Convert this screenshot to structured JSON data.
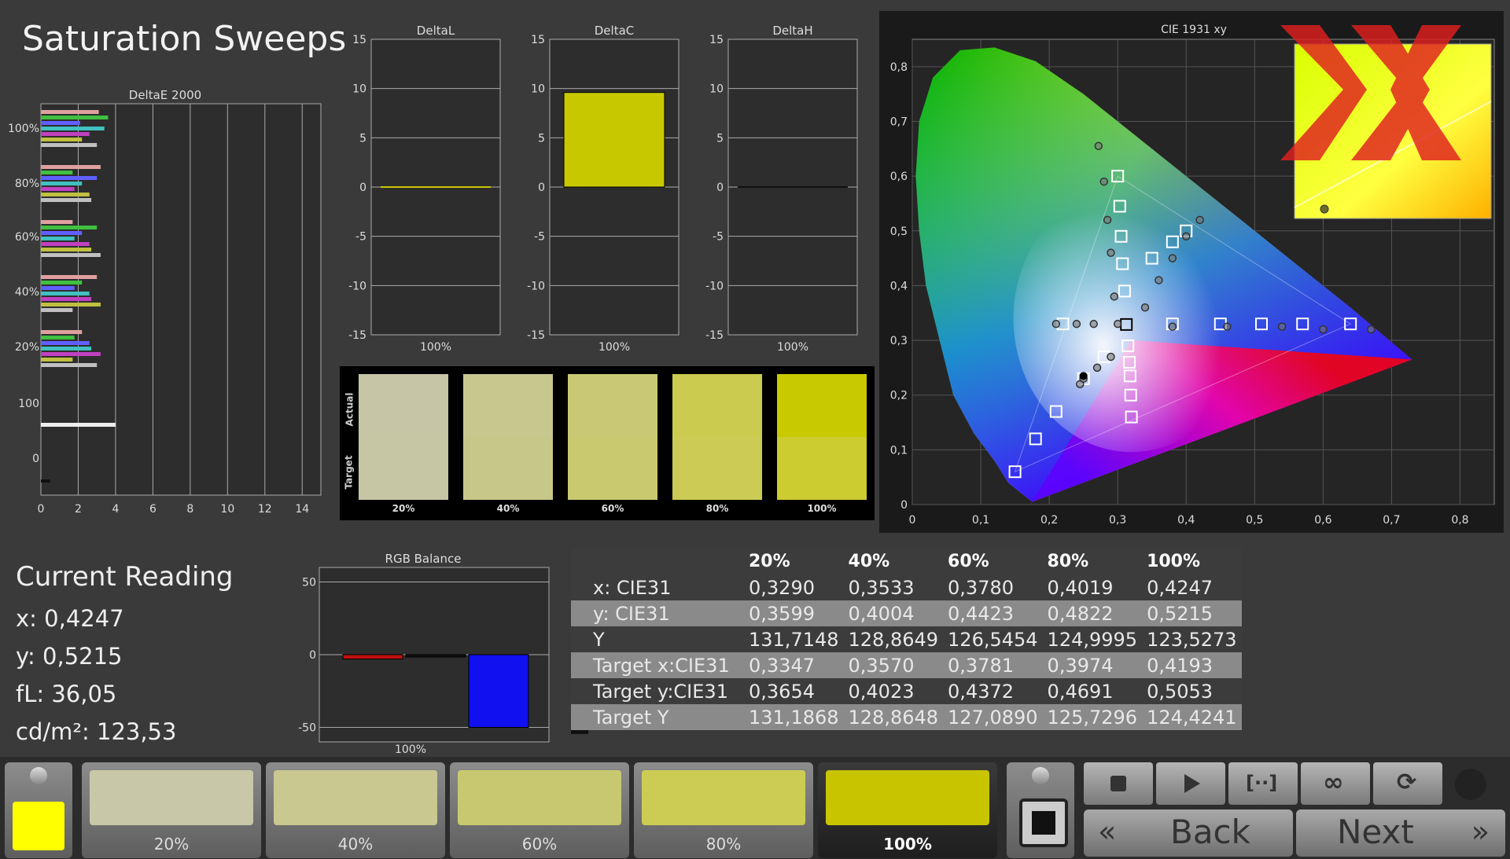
{
  "page_title": "Saturation Sweeps",
  "deltae": {
    "title": "DeltaE 2000",
    "y_labels": [
      "100%",
      "80%",
      "60%",
      "40%",
      "20%",
      "100",
      "0"
    ],
    "x_ticks": [
      "0",
      "2",
      "4",
      "6",
      "8",
      "10",
      "12",
      "14"
    ]
  },
  "mini_charts": [
    {
      "title": "DeltaL",
      "y_ticks": [
        "15",
        "10",
        "5",
        "0",
        "-5",
        "-10",
        "-15"
      ],
      "x_label": "100%",
      "value": 0,
      "color": "#c8c800"
    },
    {
      "title": "DeltaC",
      "y_ticks": [
        "15",
        "10",
        "5",
        "0",
        "-5",
        "-10",
        "-15"
      ],
      "x_label": "100%",
      "value": 9.6,
      "color": "#c8c800"
    },
    {
      "title": "DeltaH",
      "y_ticks": [
        "15",
        "10",
        "5",
        "0",
        "-5",
        "-10",
        "-15"
      ],
      "x_label": "100%",
      "value": 0,
      "color": "#c8c800"
    }
  ],
  "swatches": {
    "actual_label": "Actual",
    "target_label": "Target",
    "items": [
      {
        "label": "20%",
        "actual": "#c6c6a6",
        "target": "#c6c6a4"
      },
      {
        "label": "40%",
        "actual": "#c7c78e",
        "target": "#c7c78a"
      },
      {
        "label": "60%",
        "actual": "#c9c975",
        "target": "#c9c970"
      },
      {
        "label": "80%",
        "actual": "#cbcb50",
        "target": "#cbcb55"
      },
      {
        "label": "100%",
        "actual": "#c9c900",
        "target": "#cccc30"
      }
    ]
  },
  "cie": {
    "title": "CIE 1931 xy",
    "x_ticks": [
      "0",
      "0,1",
      "0,2",
      "0,3",
      "0,4",
      "0,5",
      "0,6",
      "0,7",
      "0,8"
    ],
    "y_ticks": [
      "0",
      "0,1",
      "0,2",
      "0,3",
      "0,4",
      "0,5",
      "0,6",
      "0,7",
      "0,8"
    ]
  },
  "current_reading": {
    "title": "Current Reading",
    "x": "x: 0,4247",
    "y": "y: 0,5215",
    "fl": "fL: 36,05",
    "cd": "cd/m²: 123,53"
  },
  "rgb_balance": {
    "title": "RGB Balance",
    "y_ticks": [
      "50",
      "0",
      "-50"
    ],
    "x_label": "100%",
    "red": -3,
    "green": 0,
    "blue": -50
  },
  "stats_table": {
    "headers": [
      "",
      "20%",
      "40%",
      "60%",
      "80%",
      "100%"
    ],
    "rows": [
      {
        "label": "x: CIE31",
        "values": [
          "0,3290",
          "0,3533",
          "0,3780",
          "0,4019",
          "0,4247"
        ]
      },
      {
        "label": "y: CIE31",
        "values": [
          "0,3599",
          "0,4004",
          "0,4423",
          "0,4822",
          "0,5215"
        ]
      },
      {
        "label": "Y",
        "values": [
          "131,7148",
          "128,8649",
          "126,5454",
          "124,9995",
          "123,5273"
        ]
      },
      {
        "label": "Target x:CIE31",
        "values": [
          "0,3347",
          "0,3570",
          "0,3781",
          "0,3974",
          "0,4193"
        ]
      },
      {
        "label": "Target y:CIE31",
        "values": [
          "0,3654",
          "0,4023",
          "0,4372",
          "0,4691",
          "0,5053"
        ]
      },
      {
        "label": "Target Y",
        "values": [
          "131,1868",
          "128,8648",
          "127,0890",
          "125,7296",
          "124,4241"
        ]
      }
    ]
  },
  "bottom_tiles": [
    {
      "label": "20%",
      "color": "#c8c8a8"
    },
    {
      "label": "40%",
      "color": "#c8c890"
    },
    {
      "label": "60%",
      "color": "#c8c870"
    },
    {
      "label": "80%",
      "color": "#cccc55"
    },
    {
      "label": "100%",
      "color": "#c8c400"
    }
  ],
  "current_color": "#ffff00",
  "nav": {
    "back": "Back",
    "next": "Next"
  },
  "icons": {
    "stop": "stop-icon",
    "play": "play-icon",
    "range": "range-icon",
    "loop": "loop-icon",
    "refresh": "refresh-icon"
  }
}
